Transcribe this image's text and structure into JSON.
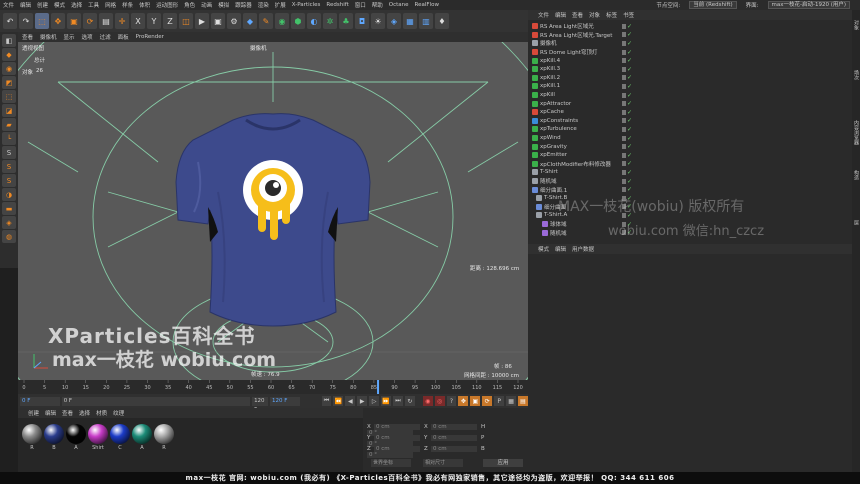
{
  "menubar": {
    "items": [
      "文件",
      "编辑",
      "创建",
      "模式",
      "选择",
      "工具",
      "网格",
      "样条",
      "体积",
      "运动图形",
      "角色",
      "动画",
      "模拟",
      "跟踪器",
      "渲染",
      "扩展",
      "X-Particles",
      "Redshift",
      "窗口",
      "帮助",
      "Octane",
      "RealFlow"
    ],
    "node_space_label": "节点空间:",
    "node_space_value": "当前 (Redshift)",
    "layout_label": "界面:",
    "layout_value": "max一枝花-启动-1920 (用户)"
  },
  "viewport": {
    "menu": [
      "查看",
      "摄像机",
      "显示",
      "选项",
      "过滤",
      "面板",
      "ProRender"
    ],
    "view_name": "透视视图",
    "camera_label": "摄像机",
    "stats_total": "总计",
    "stats_objects_label": "对象",
    "stats_objects_value": "26",
    "distance_label": "距离 : 128.696 cm",
    "fps_label": "帧速 : 76.9",
    "frame_label": "帧 : 86",
    "grid_label": "网格间距 : 10000 cm",
    "tshirt_color": "#3d4a8c",
    "logo_yellow": "#f6be1a"
  },
  "timeline": {
    "ticks": [
      "0",
      "5",
      "10",
      "15",
      "20",
      "25",
      "30",
      "35",
      "40",
      "45",
      "50",
      "55",
      "60",
      "65",
      "70",
      "75",
      "80",
      "85",
      "90",
      "95",
      "100",
      "105",
      "110",
      "115",
      "120"
    ],
    "current_frame": "86",
    "current_label": "86 F"
  },
  "transport": {
    "start": "0 F",
    "current": "0 F",
    "end": "120 F",
    "end2": "120 F"
  },
  "materials": {
    "menu": [
      "创建",
      "编辑",
      "查看",
      "选择",
      "材质",
      "纹理"
    ],
    "items": [
      {
        "name": "R",
        "color": "#8c8c8c"
      },
      {
        "name": "B",
        "color": "#2a3c8c"
      },
      {
        "name": "A",
        "color": "#050505"
      },
      {
        "name": "Shirt",
        "color": "#c83cc8"
      },
      {
        "name": "C",
        "color": "#1c3cc8"
      },
      {
        "name": "A",
        "color": "#1c8c78"
      },
      {
        "name": "R",
        "color": "#a8a8a8"
      }
    ]
  },
  "coords": {
    "rows": [
      {
        "a": "X",
        "av": "0 cm",
        "b": "X",
        "bv": "0 cm",
        "c": "H",
        "cv": "0 °"
      },
      {
        "a": "Y",
        "av": "0 cm",
        "b": "Y",
        "bv": "0 cm",
        "c": "P",
        "cv": "0 °"
      },
      {
        "a": "Z",
        "av": "0 cm",
        "b": "Z",
        "bv": "0 cm",
        "c": "B",
        "cv": "0 °"
      }
    ],
    "mode": "世界坐标",
    "scale_mode": "相对尺寸",
    "apply": "应用"
  },
  "objects": {
    "menu": [
      "文件",
      "编辑",
      "查看",
      "对象",
      "标签",
      "书签"
    ],
    "rows": [
      {
        "name": "RS Area Light区域光",
        "color": "#d84a3a"
      },
      {
        "name": "RS Area Light区域光.Target",
        "color": "#d84a3a"
      },
      {
        "name": "摄像机",
        "color": "#9aa0a8"
      },
      {
        "name": "RS Dome Light穹顶灯",
        "color": "#d84a3a"
      },
      {
        "name": "xpKill.4",
        "color": "#3ab04a"
      },
      {
        "name": "xpKill.3",
        "color": "#3ab04a"
      },
      {
        "name": "xpKill.2",
        "color": "#3ab04a"
      },
      {
        "name": "xpKill.1",
        "color": "#3ab04a"
      },
      {
        "name": "xpKill",
        "color": "#3ab04a"
      },
      {
        "name": "xpAttractor",
        "color": "#3ab04a"
      },
      {
        "name": "xpCache",
        "color": "#d84a3a"
      },
      {
        "name": "xpConstraints",
        "color": "#3a8cd8"
      },
      {
        "name": "xpTurbulence",
        "color": "#3ab04a"
      },
      {
        "name": "xpWind",
        "color": "#3ab04a"
      },
      {
        "name": "xpGravity",
        "color": "#3ab04a"
      },
      {
        "name": "xpEmitter",
        "color": "#3ab04a"
      },
      {
        "name": "xpClothModifier布料修改器",
        "color": "#3ab04a"
      },
      {
        "name": "T-Shirt",
        "color": "#9aa0a8"
      },
      {
        "name": "随机域",
        "color": "#9aa0a8"
      },
      {
        "name": "细分曲面.1",
        "color": "#6a8cd8"
      },
      {
        "name": "T-Shirt.B",
        "color": "#9aa0a8"
      },
      {
        "name": "细分曲面",
        "color": "#6a8cd8"
      },
      {
        "name": "T-Shirt.A",
        "color": "#9aa0a8"
      },
      {
        "name": "球体域",
        "color": "#9a6ad8"
      },
      {
        "name": "随机域",
        "color": "#9a6ad8"
      }
    ]
  },
  "attributes": {
    "menu": [
      "模式",
      "编辑",
      "用户数据"
    ]
  },
  "rightstrip": [
    "对象",
    "场次",
    "内容浏览器",
    "构造",
    "层"
  ],
  "watermarks": {
    "w1": "XParticles百科全书",
    "w2": "max一枝花 wobiu.com",
    "w3": "MAX一枝花(wobiu)  版权所有",
    "w4": "wobiu.com  微信:hn_czcz"
  },
  "bottombar": "max一枝花 官网: wobiu.com (我必有)   《X-Particles百科全书》我必有网独家销售，其它途径均为盗版，欢迎举报！   QQ: 344 611 606"
}
